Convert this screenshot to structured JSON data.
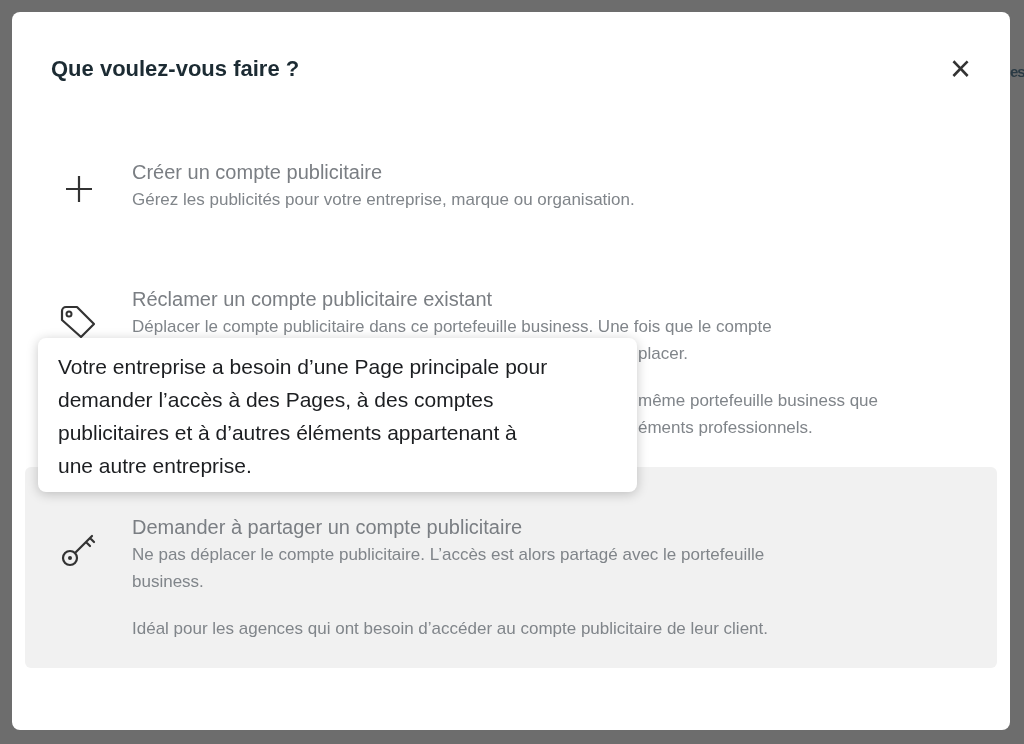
{
  "background_text": "es",
  "dialog": {
    "title": "Que voulez-vous faire ?",
    "close_label": "×"
  },
  "options": [
    {
      "highlighted": false,
      "title": "Créer un compte publicitaire",
      "paragraphs": [
        [
          {
            "text": "Gérez les publicités pour votre entreprise, marque ou organisation."
          }
        ]
      ]
    },
    {
      "highlighted": false,
      "title": "Réclamer un compte publicitaire existant",
      "paragraphs": [
        [
          {
            "text": "Déplacer le compte publicitaire dans ce portefeuille business. Une fois que le compte",
            "covered": false
          },
          {
            "text": "placer.",
            "covered": true
          }
        ],
        [
          {
            "text": "même portefeuille business que",
            "covered": true
          },
          {
            "text": "éments professionnels.",
            "covered": true
          }
        ]
      ]
    },
    {
      "highlighted": true,
      "title": "Demander à partager un compte publicitaire",
      "paragraphs": [
        [
          {
            "text": "Ne pas déplacer le compte publicitaire. L’accès est alors partagé avec le portefeuille"
          },
          {
            "text": "business."
          }
        ],
        [
          {
            "text": "Idéal pour les agences qui ont besoin d’accéder au compte publicitaire de leur client."
          }
        ]
      ]
    }
  ],
  "tooltip": {
    "text": "Votre entreprise a besoin d’une Page principale pour demander l’accès à des Pages, à des comptes publicitaires et à d’autres éléments appartenant à une autre entreprise."
  }
}
